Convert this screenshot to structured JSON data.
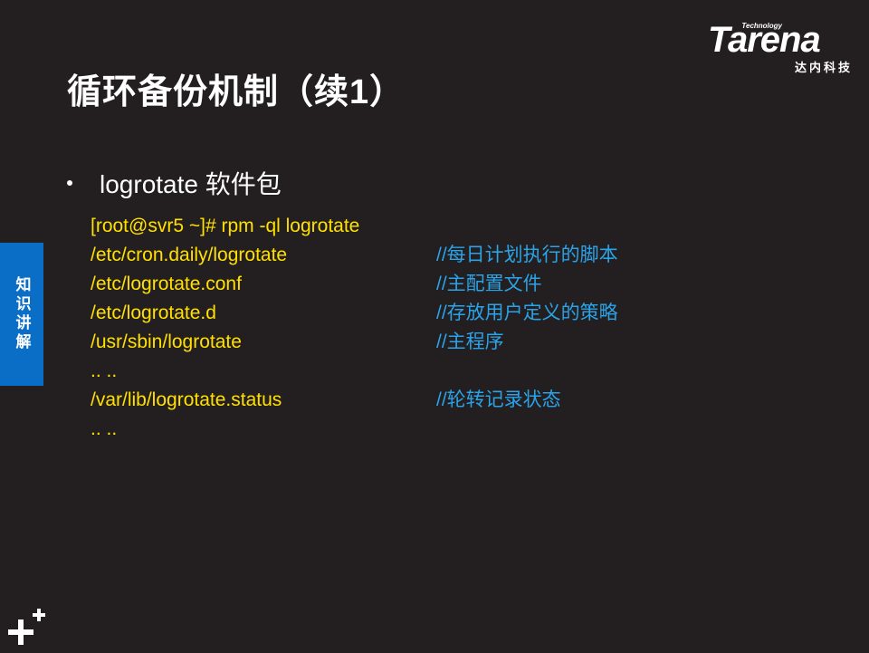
{
  "slide": {
    "title": "循环备份机制（续1）",
    "side_tab": "知识讲解",
    "bullet": "logrotate 软件包"
  },
  "logo": {
    "word": "Tarena",
    "tag": "Technology",
    "cn": "达内科技"
  },
  "code_lines": [
    {
      "cmd": "[root@svr5 ~]# rpm  -ql  logrotate",
      "comment": ""
    },
    {
      "cmd": "/etc/cron.daily/logrotate",
      "comment": "//每日计划执行的脚本"
    },
    {
      "cmd": "/etc/logrotate.conf",
      "comment": "//主配置文件"
    },
    {
      "cmd": "/etc/logrotate.d",
      "comment": "//存放用户定义的策略"
    },
    {
      "cmd": "/usr/sbin/logrotate",
      "comment": "//主程序"
    },
    {
      "cmd": ".. ..",
      "comment": ""
    },
    {
      "cmd": "/var/lib/logrotate.status",
      "comment": "//轮转记录状态"
    },
    {
      "cmd": ".. ..",
      "comment": ""
    }
  ],
  "colors": {
    "background": "#231f20",
    "command": "#ffe000",
    "comment": "#2aa3e8",
    "tab": "#0a6ec6"
  },
  "icons": {
    "bottom_left": "plus-icon"
  }
}
